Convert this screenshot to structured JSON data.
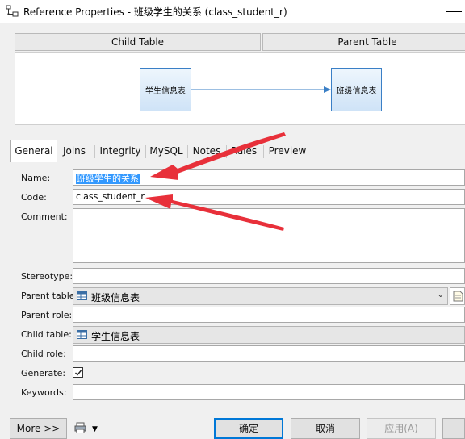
{
  "window": {
    "title": "Reference Properties - 班级学生的关系 (class_student_r)"
  },
  "diagram": {
    "child_header": "Child Table",
    "parent_header": "Parent Table",
    "child_node": "学生信息表",
    "parent_node": "班级信息表"
  },
  "tabs": [
    {
      "label": "General",
      "active": true
    },
    {
      "label": "Joins"
    },
    {
      "label": "Integrity"
    },
    {
      "label": "MySQL"
    },
    {
      "label": "Notes"
    },
    {
      "label": "Rules"
    },
    {
      "label": "Preview"
    }
  ],
  "form": {
    "name_label": "Name:",
    "name_value": "班级学生的关系",
    "code_label": "Code:",
    "code_value": "class_student_r",
    "comment_label": "Comment:",
    "comment_value": "",
    "stereotype_label": "Stereotype:",
    "stereotype_value": "",
    "parent_table_label": "Parent table:",
    "parent_table_value": "班级信息表",
    "parent_role_label": "Parent role:",
    "parent_role_value": "",
    "child_table_label": "Child table:",
    "child_table_value": "学生信息表",
    "child_role_label": "Child role:",
    "child_role_value": "",
    "generate_label": "Generate:",
    "generate_checked": true,
    "keywords_label": "Keywords:",
    "keywords_value": ""
  },
  "buttons": {
    "more": "More >>",
    "ok": "确定",
    "cancel": "取消",
    "apply": "应用(A)"
  },
  "colors": {
    "annotation_arrow": "#e8303a",
    "selection": "#3399ff",
    "node_border": "#3a7fc6",
    "default_button_border": "#0078d7"
  },
  "icons": {
    "app": "reference-properties-icon",
    "table": "table-icon",
    "print": "print-icon",
    "properties": "properties-icon"
  }
}
